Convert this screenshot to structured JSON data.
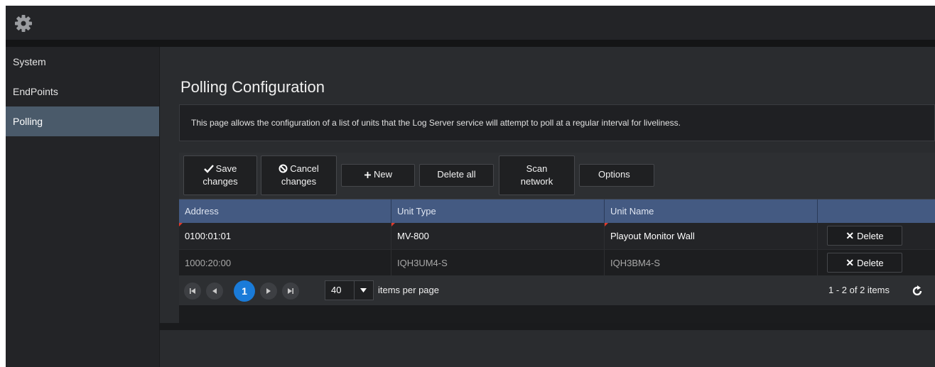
{
  "icons": {
    "settings": "gear-icon",
    "save": "check-icon",
    "cancel": "ban-icon",
    "new": "plus-icon",
    "delete": "x-icon",
    "refresh": "refresh-icon"
  },
  "colors": {
    "background": "#2a2c2f",
    "header_row": "#445a82",
    "active_nav": "#4a5a6a",
    "active_page": "#1a7bd8",
    "dirty_flag": "#e23a2a"
  },
  "sidebar": {
    "items": [
      {
        "label": "System"
      },
      {
        "label": "EndPoints"
      },
      {
        "label": "Polling",
        "active": true
      }
    ]
  },
  "page": {
    "title": "Polling Configuration",
    "description": "This page allows the configuration of a list of units that the Log Server service will attempt to poll at a regular interval for liveliness."
  },
  "toolbar": {
    "save_line1": "Save",
    "save_line2": "changes",
    "cancel_line1": "Cancel",
    "cancel_line2": "changes",
    "new": "New",
    "delete_all": "Delete all",
    "scan_line1": "Scan",
    "scan_line2": "network",
    "options": "Options"
  },
  "grid": {
    "columns": [
      "Address",
      "Unit Type",
      "Unit Name",
      ""
    ],
    "rows": [
      {
        "address": "0100:01:01",
        "unit_type": "MV-800",
        "unit_name": "Playout Monitor Wall",
        "action": "Delete"
      },
      {
        "address": "1000:20:00",
        "unit_type": "IQH3UM4-S",
        "unit_name": "IQH3BM4-S",
        "action": "Delete"
      }
    ]
  },
  "pager": {
    "current_page": "1",
    "page_size": "40",
    "items_per_page": "items per page",
    "count": "1 - 2 of 2 items"
  }
}
